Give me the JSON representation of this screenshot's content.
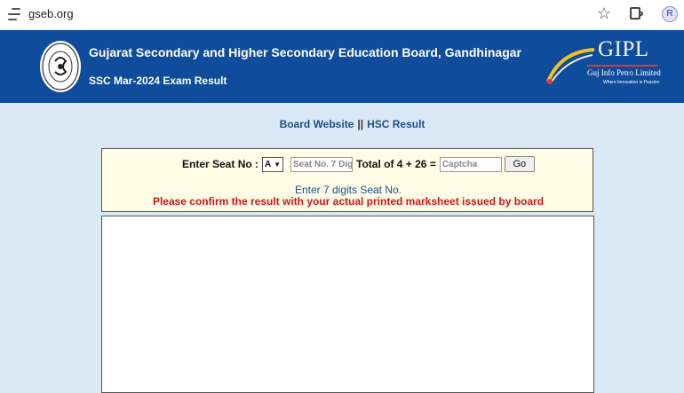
{
  "browser": {
    "url": "gseb.org",
    "profile_initial": "R"
  },
  "header": {
    "board_title": "Gujarat Secondary and Higher Secondary Education Board, Gandhinagar",
    "exam_title": "SSC Mar-2024 Exam Result",
    "partner_logo_text": "GIPL",
    "partner_name": "Guj Info Petro Limited",
    "partner_tagline": "Where Innovation is Passion"
  },
  "links": {
    "board_website": "Board Website",
    "separator": "||",
    "hsc_result": "HSC Result"
  },
  "form": {
    "seat_label": "Enter Seat No :",
    "seat_series_selected": "A",
    "seat_placeholder": "Seat No. 7 Digit",
    "captcha_question": "Total of 4 + 26 =",
    "captcha_placeholder": "Captcha",
    "go_label": "Go",
    "hint": "Enter 7 digits Seat No.",
    "warning": "Please confirm the result with your actual printed marksheet issued by board"
  },
  "colors": {
    "header_bg": "#0f4c9b",
    "page_bg": "#dbe9f7",
    "panel_bg": "#fffde6",
    "link": "#1a4e8f",
    "warning": "#d0141a"
  },
  "icons": [
    "site-info-icon",
    "star-icon",
    "extensions-icon",
    "board-emblem-icon",
    "gipl-swoosh-icon"
  ]
}
